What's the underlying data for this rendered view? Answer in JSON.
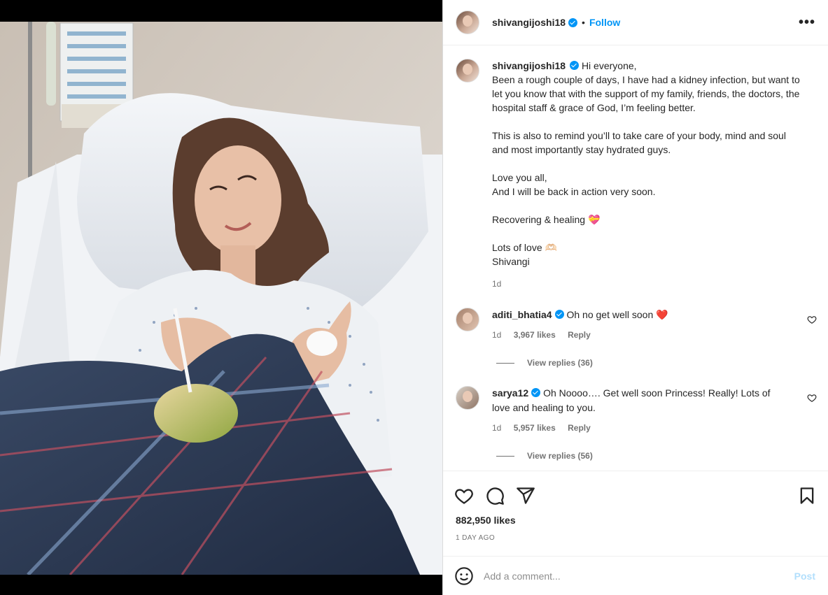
{
  "post": {
    "username": "shivangijoshi18",
    "follow_label": "Follow",
    "more_label": "•••",
    "dot": "•"
  },
  "caption": {
    "username": "shivangijoshi18",
    "lines": [
      "Hi everyone,",
      "Been a rough couple of days, I have had a kidney infection, but want to let you know that with the support of my family, friends, the doctors, the hospital staff & grace of God, I’m feeling better.",
      "",
      "This is also to remind you’ll to take care of your body, mind and soul and most importantly stay hydrated guys.",
      "",
      "Love you all,",
      "And I will be back in action very soon.",
      "",
      "Recovering & healing 💝",
      "",
      "Lots of love 🫶🏻",
      "Shivangi"
    ],
    "time": "1d"
  },
  "comments": [
    {
      "username": "aditi_bhatia4",
      "text": "Oh no get well soon ❤️",
      "time": "1d",
      "likes": "3,967 likes",
      "reply_label": "Reply",
      "view_replies": "View replies (36)"
    },
    {
      "username": "sarya12",
      "text": "Oh Noooo…. Get well soon Princess! Really! Lots of love and healing to you.",
      "time": "1d",
      "likes": "5,957 likes",
      "reply_label": "Reply",
      "view_replies": "View replies (56)"
    }
  ],
  "actions": {
    "icons": [
      "heart-icon",
      "comment-icon",
      "share-icon",
      "bookmark-icon"
    ],
    "likes": "882,950 likes",
    "posted_ago": "1 DAY AGO"
  },
  "add_comment": {
    "placeholder": "Add a comment...",
    "post_label": "Post"
  },
  "colors": {
    "accent": "#0095f6",
    "post_disabled": "#b2dffc",
    "heart_red": "#e0245e"
  }
}
